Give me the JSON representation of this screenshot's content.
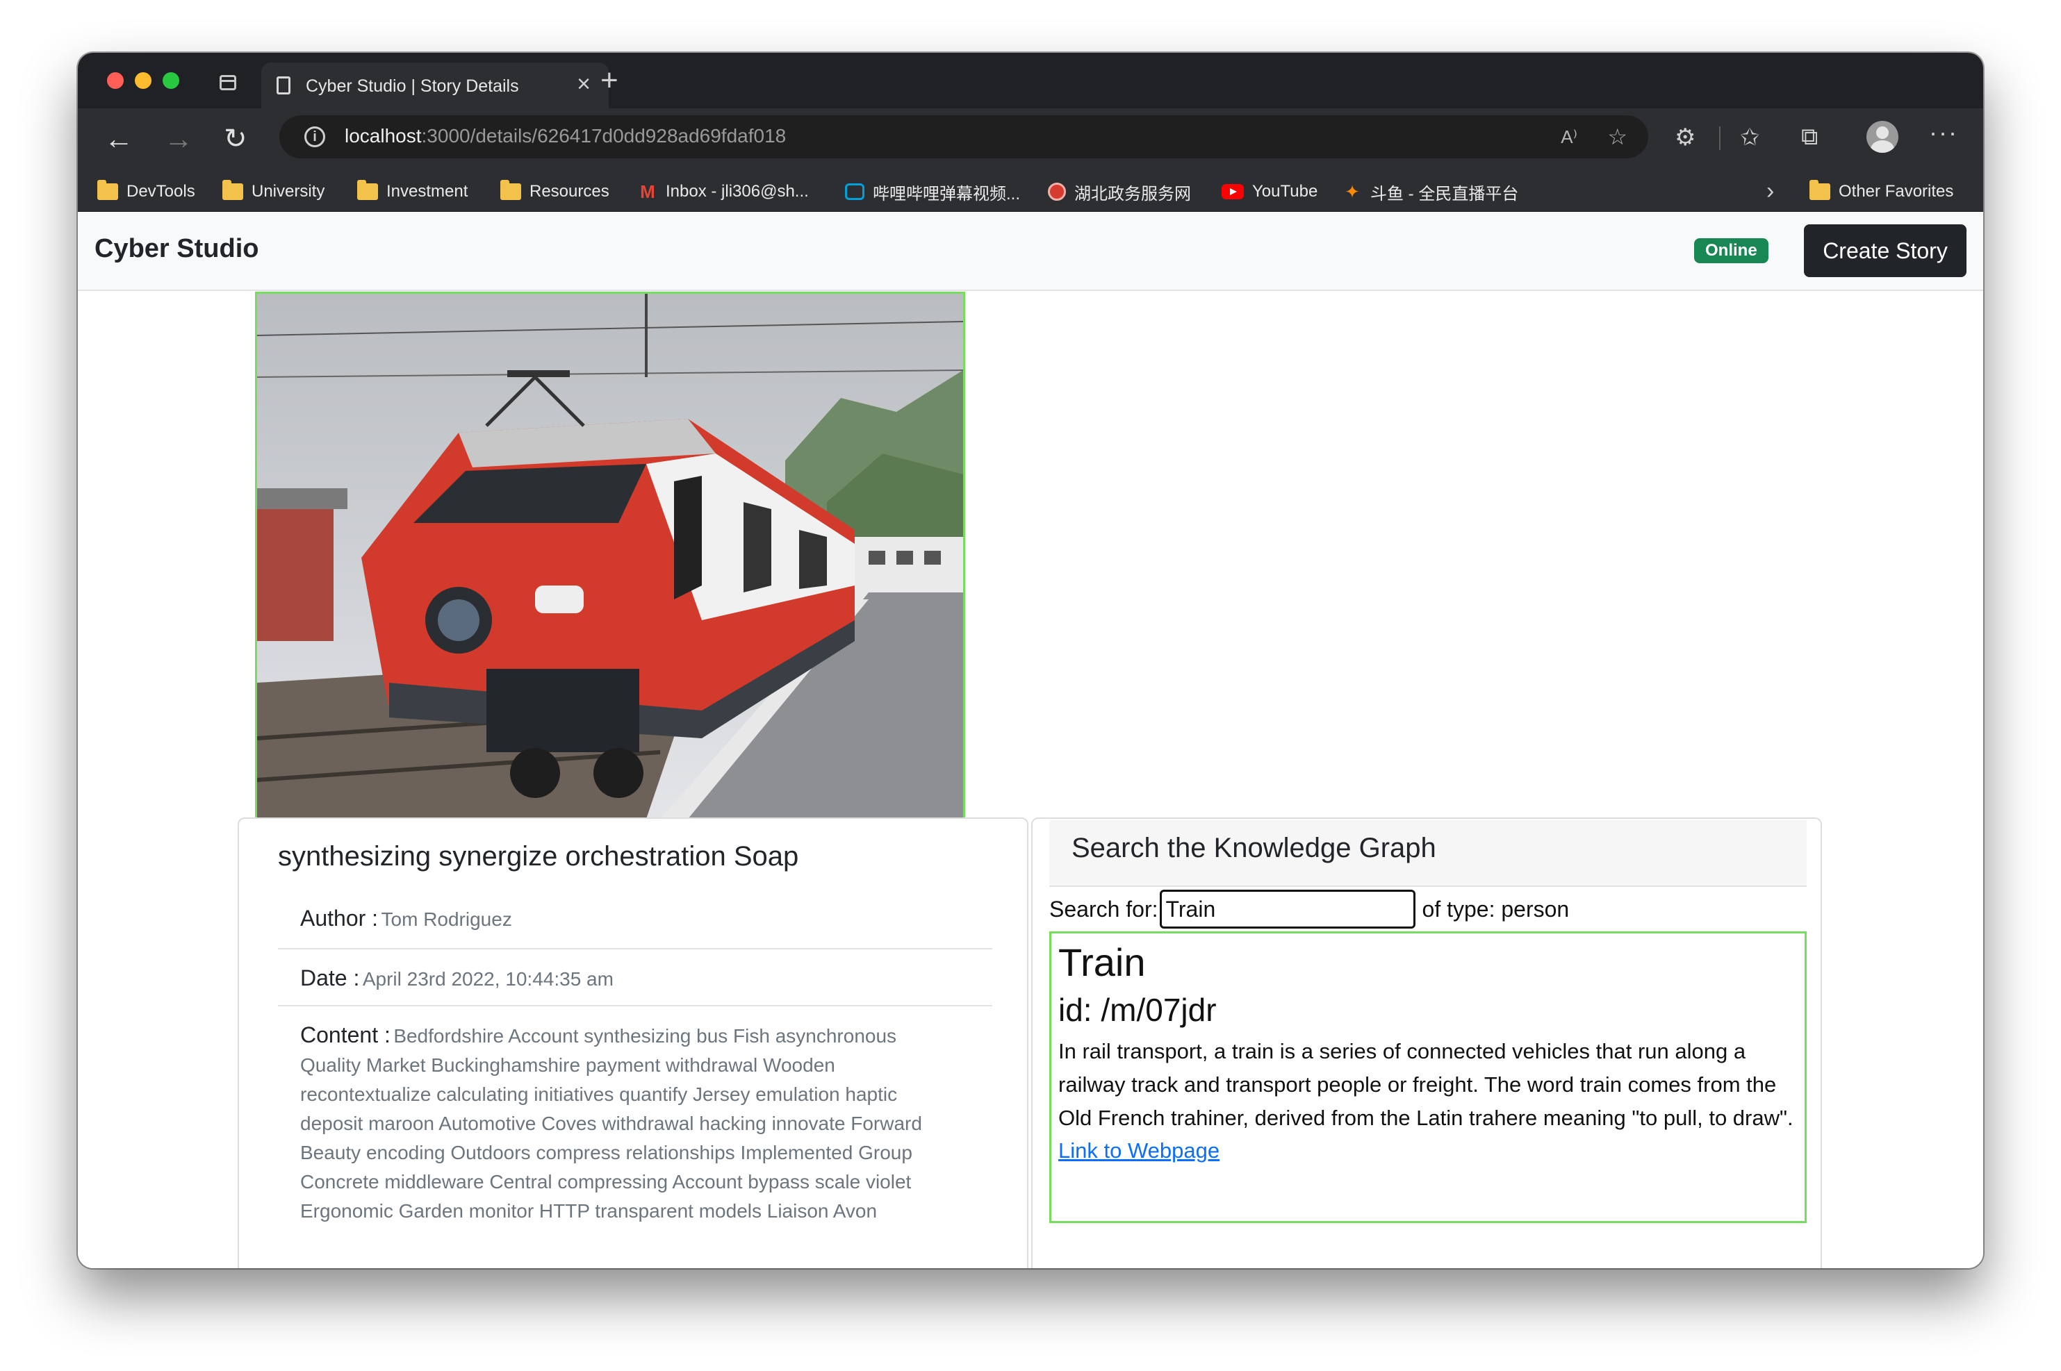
{
  "browser": {
    "tab_title": "Cyber Studio | Story Details",
    "url_host": "localhost",
    "url_path": ":3000/details/626417d0dd928ad69fdaf018",
    "bookmarks": [
      {
        "label": "DevTools",
        "icon": "folder-icon"
      },
      {
        "label": "University",
        "icon": "folder-icon"
      },
      {
        "label": "Investment",
        "icon": "folder-icon"
      },
      {
        "label": "Resources",
        "icon": "folder-icon"
      },
      {
        "label": "Inbox - jli306@sh...",
        "icon": "gmail-icon"
      },
      {
        "label": "哔哩哔哩弹幕视频...",
        "icon": "bilibili-icon"
      },
      {
        "label": "湖北政务服务网",
        "icon": "hubei-icon"
      },
      {
        "label": "YouTube",
        "icon": "youtube-icon"
      },
      {
        "label": "斗鱼 - 全民直播平台",
        "icon": "douyu-icon"
      }
    ],
    "other_favorites": "Other Favorites"
  },
  "navbar": {
    "brand": "Cyber Studio",
    "status": "Online",
    "status_color": "#198754",
    "create_button": "Create Story"
  },
  "story": {
    "title": "synthesizing synergize orchestration Soap",
    "author_label": "Author :",
    "author": "Tom Rodriguez",
    "date_label": "Date :",
    "date": "April 23rd 2022, 10:44:35 am",
    "content_label": "Content :",
    "content": "Bedfordshire Account synthesizing bus Fish asynchronous Quality Market Buckinghamshire payment withdrawal Wooden recontextualize calculating initiatives quantify Jersey emulation haptic deposit maroon Automotive Coves withdrawal hacking innovate Forward Beauty encoding Outdoors compress relationships Implemented Group Concrete middleware Central compressing Account bypass scale violet Ergonomic Garden monitor HTTP transparent models Liaison Avon"
  },
  "knowledge_graph": {
    "header": "Search the Knowledge Graph",
    "search_label": "Search for:",
    "search_value": "Train",
    "type_label": "of type: person",
    "result": {
      "name": "Train",
      "id": "id: /m/07jdr",
      "description": "In rail transport, a train is a series of connected vehicles that run along a railway track and transport people or freight. The word train comes from the Old French trahiner, derived from the Latin trahere meaning \"to pull, to draw\".",
      "link_text": "Link to Webpage"
    }
  },
  "colors": {
    "highlight_border": "#77dd5f",
    "link": "#0d6efd"
  }
}
